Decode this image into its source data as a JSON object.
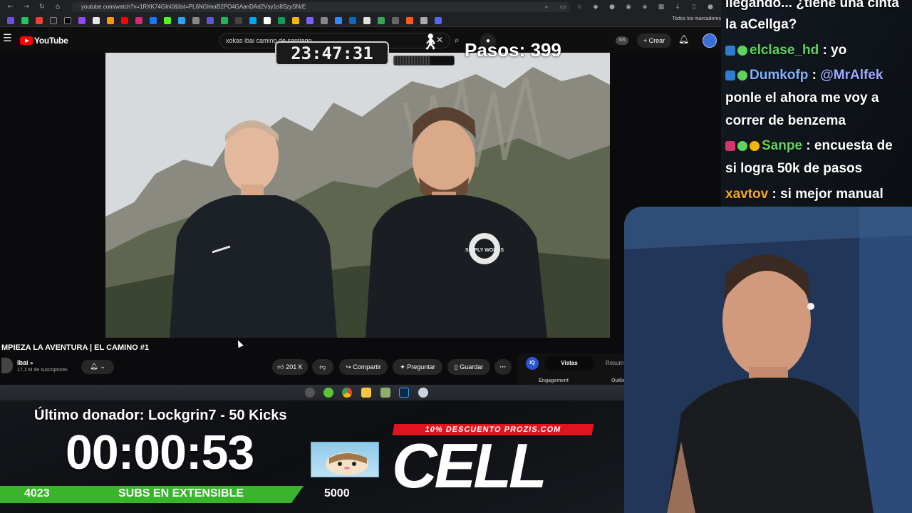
{
  "browser": {
    "url": "youtube.com/watch?v=1RXK74GIni0&list=PL6NGlmaB2PO4GAanDAd2Vsy1o8SzySNrE",
    "bookmarks_folder": "Todos los marcadores"
  },
  "youtube": {
    "brand": "YouTube",
    "search_value": "xokas ibai camino de santiago",
    "create_label": "Crear",
    "ss_badge": "SS"
  },
  "overlay": {
    "clock": "23:47:31",
    "steps_label": "Pasos: 399",
    "steps_progress": 0.6
  },
  "video": {
    "title": "MPIEZA LA AVENTURA | EL CAMINO #1",
    "channel": "Ibai",
    "subscribers": "17,1 M de suscriptores",
    "likes": "201 K",
    "share_label": "Compartir",
    "ask_label": "Preguntar",
    "save_label": "Guardar",
    "shirt_text": "SIMPLY WORKS"
  },
  "side_panel": {
    "iq_label": "IQ",
    "tab_active": "Vistas",
    "tab_other": "Resum",
    "engagement": "Engagement",
    "outline": "Outlie"
  },
  "stream": {
    "last_donor": "Último donador: Lockgrin7 - 50 Kicks",
    "countdown": "00:00:53",
    "promo": "10% DESCUENTO PROZIS.COM",
    "logo": "CELL",
    "subs_current": "4023",
    "subs_label": "SUBS EN EXTENSIBLE",
    "subs_goal": "5000",
    "subs_progress": 0.805
  },
  "chat": {
    "lines": [
      {
        "user": "",
        "text": "llegando... ¿tiene una cinta"
      },
      {
        "user": "",
        "text": "la aCellga?"
      },
      {
        "user": "elclase_hd",
        "text": " : yo"
      },
      {
        "user": "Dumkofp",
        "text": " : ",
        "mention": "@MrAlfek"
      },
      {
        "user": "",
        "text": "ponle el ahora me voy a"
      },
      {
        "user": "",
        "text": "correr de benzema"
      },
      {
        "user": "Sanpe",
        "text": " : encuesta de"
      },
      {
        "user": "",
        "text": "si logra 50k de pasos"
      },
      {
        "user": "xavtov",
        "text": " : si mejor manual"
      }
    ]
  },
  "colors": {
    "accent_green": "#38b52b",
    "promo_red": "#e0141e",
    "youtube_red": "#ff0000",
    "chat_user_green": "#5fd35f",
    "xavtov_orange": "#f5a623"
  }
}
